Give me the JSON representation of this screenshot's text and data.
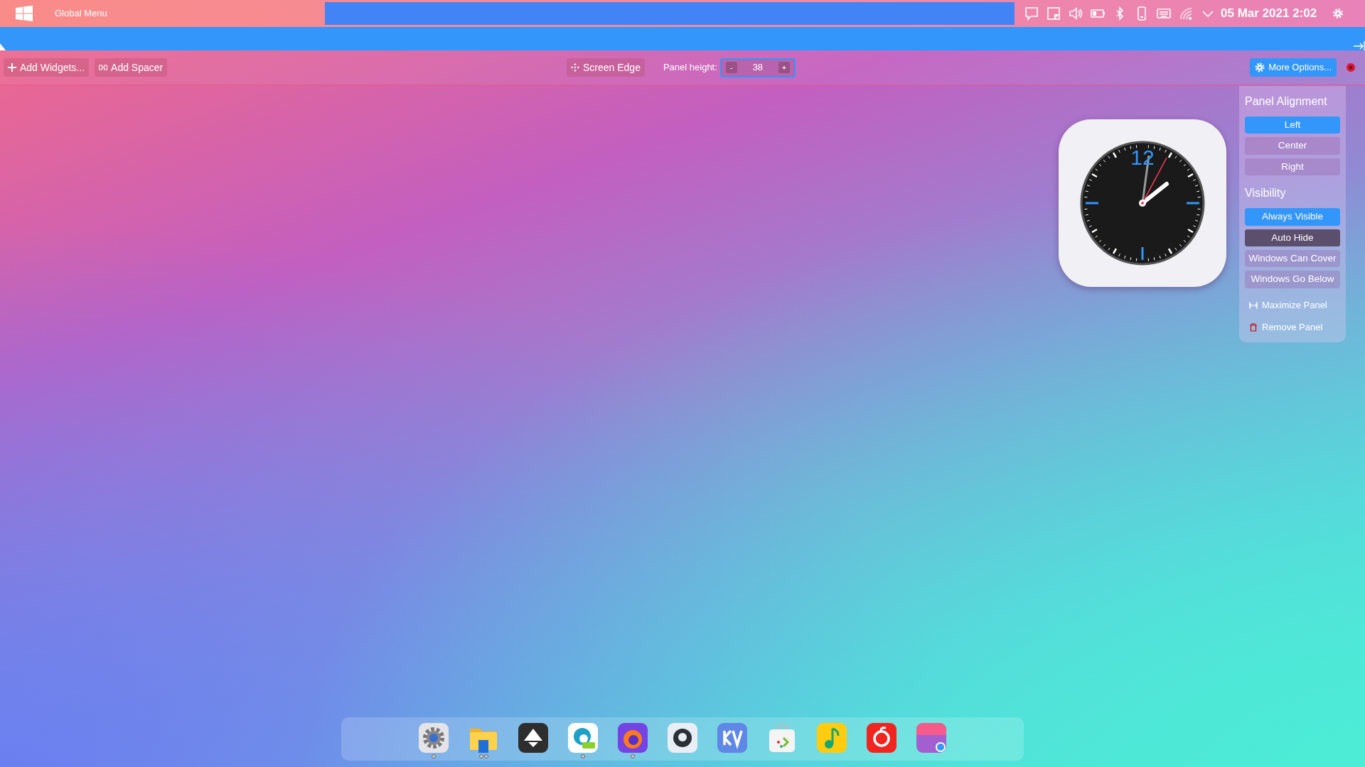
{
  "top_bar": {
    "menu_label": "Global Menu",
    "datetime": "05 Mar 2021 2:02"
  },
  "edit_toolbar": {
    "left_buttons": [
      {
        "label": "Add Widgets...",
        "kind": "plus"
      },
      {
        "label": "Add Spacer",
        "kind": "spacer"
      }
    ],
    "screen_edge": "Screen Edge",
    "panel_height": {
      "label": "Panel height:",
      "value": "38",
      "decrement": "-",
      "increment": "+"
    },
    "more_options": "More Options..."
  },
  "clock": {
    "numeral": "12"
  },
  "options_panel": {
    "sections": [
      {
        "title": "Panel Alignment",
        "items": [
          {
            "label": "Left",
            "selected": true,
            "highlighted": false
          },
          {
            "label": "Center",
            "selected": false,
            "highlighted": false
          },
          {
            "label": "Right",
            "selected": false,
            "highlighted": false
          }
        ]
      },
      {
        "title": "Visibility",
        "items": [
          {
            "label": "Always Visible",
            "selected": true,
            "highlighted": false
          },
          {
            "label": "Auto Hide",
            "selected": false,
            "highlighted": true
          },
          {
            "label": "Windows Can Cover",
            "selected": false,
            "highlighted": false
          },
          {
            "label": "Windows Go Below",
            "selected": false,
            "highlighted": false
          }
        ]
      }
    ],
    "actions": [
      {
        "label": "Maximize Panel",
        "kind": "maximize"
      },
      {
        "label": "Remove Panel",
        "kind": "remove"
      }
    ]
  },
  "dock": {
    "apps": [
      {
        "running": true,
        "multiple_windows": false
      },
      {
        "running": true,
        "multiple_windows": true
      },
      {
        "running": false,
        "multiple_windows": false
      },
      {
        "running": true,
        "multiple_windows": false
      },
      {
        "running": true,
        "multiple_windows": false
      },
      {
        "running": false,
        "multiple_windows": false
      },
      {
        "running": false,
        "multiple_windows": false
      },
      {
        "running": false,
        "multiple_windows": false
      },
      {
        "running": false,
        "multiple_windows": false
      },
      {
        "running": false,
        "multiple_windows": false
      },
      {
        "running": false,
        "multiple_windows": false
      }
    ]
  }
}
